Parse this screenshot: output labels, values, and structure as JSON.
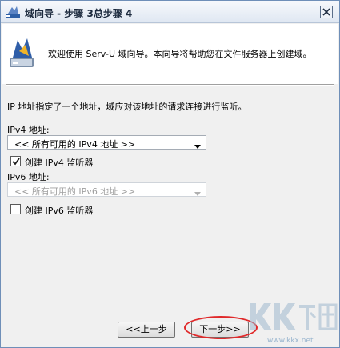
{
  "window": {
    "title": "域向导 - 步骤 3总步骤 4"
  },
  "header": {
    "welcome_text": "欢迎使用 Serv-U 域向导。本向导将帮助您在文件服务器上创建域。"
  },
  "content": {
    "description": "IP 地址指定了一个地址，域应对该地址的请求连接进行监听。",
    "ipv4": {
      "label": "IPv4 地址:",
      "selected": "<< 所有可用的 IPv4 地址 >>",
      "checkbox_label": "创建 IPv4 监听器",
      "checked": true
    },
    "ipv6": {
      "label": "IPv6 地址:",
      "selected": "<< 所有可用的 IPv6 地址 >>",
      "checkbox_label": "创建 IPv6 监听器",
      "checked": false,
      "disabled": true
    }
  },
  "footer": {
    "back_label": "<<上一步",
    "next_label": "下一步>>"
  },
  "watermark": {
    "logo_text": "KK下载",
    "url": "www.kkx.net"
  },
  "colors": {
    "highlight": "#e0292a",
    "title_bar": "#dfe7f2"
  }
}
